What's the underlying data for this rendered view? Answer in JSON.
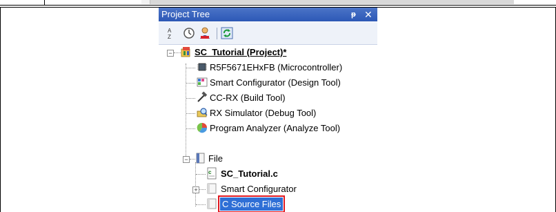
{
  "panel": {
    "title": "Project Tree",
    "pin_label": "ᵽ",
    "close_label": "✕"
  },
  "toolbar": {
    "buttons": [
      {
        "name": "sort-icon"
      },
      {
        "name": "clock-icon"
      },
      {
        "name": "user-icon"
      },
      {
        "name": "refresh-icon"
      }
    ]
  },
  "tree": {
    "project": "SC_Tutorial (Project)*",
    "items": [
      {
        "label": "R5F5671EHxFB (Microcontroller)",
        "icon": "microcontroller-icon"
      },
      {
        "label": "Smart Configurator (Design Tool)",
        "icon": "design-tool-icon"
      },
      {
        "label": "CC-RX (Build Tool)",
        "icon": "build-tool-icon"
      },
      {
        "label": "RX Simulator (Debug Tool)",
        "icon": "debug-tool-icon"
      },
      {
        "label": "Program Analyzer (Analyze Tool)",
        "icon": "analyze-tool-icon"
      }
    ],
    "file_folder": "File",
    "files": [
      {
        "label": "SC_Tutorial.c",
        "icon": "c-file-icon"
      },
      {
        "label": "Smart Configurator",
        "icon": "folder-icon"
      },
      {
        "label": "C Source Files",
        "icon": "folder-icon"
      }
    ]
  },
  "colors": {
    "titlebar": "#2d58b6",
    "selection": "#2f6fd6",
    "highlight_border": "#e01820"
  }
}
